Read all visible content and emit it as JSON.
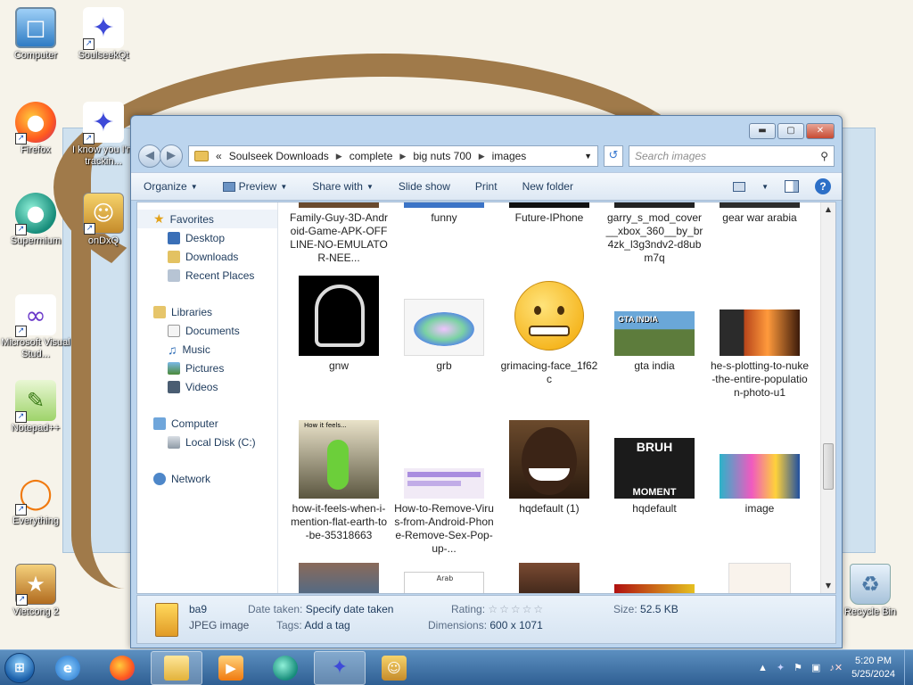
{
  "desktop": {
    "icons": [
      {
        "label": "Computer"
      },
      {
        "label": "SoulseekQt"
      },
      {
        "label": "Firefox"
      },
      {
        "label": "I know you I'm trackin..."
      },
      {
        "label": "Supermium"
      },
      {
        "label": "onDxQ"
      },
      {
        "label": "Microsoft Visual Stud..."
      },
      {
        "label": "Notepad++"
      },
      {
        "label": "Everything"
      },
      {
        "label": "Vietcong 2"
      },
      {
        "label": "Recycle Bin"
      }
    ]
  },
  "explorer": {
    "address": {
      "crumb_prefix": "«",
      "crumbs": [
        "Soulseek Downloads",
        "complete",
        "big nuts 700",
        "images"
      ]
    },
    "search_placeholder": "Search images",
    "toolbar": {
      "organize": "Organize",
      "preview": "Preview",
      "share_with": "Share with",
      "slide_show": "Slide show",
      "print": "Print",
      "new_folder": "New folder"
    },
    "nav": {
      "favorites": "Favorites",
      "desktop": "Desktop",
      "downloads": "Downloads",
      "recent_places": "Recent Places",
      "libraries": "Libraries",
      "documents": "Documents",
      "music": "Music",
      "pictures": "Pictures",
      "videos": "Videos",
      "computer": "Computer",
      "local_disk": "Local Disk (C:)",
      "network": "Network"
    },
    "files": [
      {
        "name": "Family-Guy-3D-Android-Game-APK-OFFLINE-NO-EMULATOR-NEE..."
      },
      {
        "name": "funny"
      },
      {
        "name": "Future-IPhone"
      },
      {
        "name": "garry_s_mod_cover__xbox_360__by_br4zk_l3g3ndv2-d8ubm7q"
      },
      {
        "name": "gear war arabia"
      },
      {
        "name": "gnw"
      },
      {
        "name": "grb"
      },
      {
        "name": "grimacing-face_1f62c"
      },
      {
        "name": "gta india"
      },
      {
        "name": "he-s-plotting-to-nuke-the-entire-population-photo-u1"
      },
      {
        "name": "how-it-feels-when-i-mention-flat-earth-to-be-35318663"
      },
      {
        "name": "How-to-Remove-Virus-from-Android-Phone-Remove-Sex-Pop-up-..."
      },
      {
        "name": "hqdefault (1)"
      },
      {
        "name": "hqdefault"
      },
      {
        "name": "image"
      }
    ],
    "thumb_text": {
      "gta_india": "GTA INDIA",
      "bruh": "BRUH",
      "moment": "MOMENT",
      "arab": "Arab",
      "how_it_feels": "How it feels..."
    },
    "details": {
      "filename": "ba9",
      "filetype": "JPEG image",
      "date_taken_label": "Date taken:",
      "date_taken_value": "Specify date taken",
      "tags_label": "Tags:",
      "tags_value": "Add a tag",
      "rating_label": "Rating:",
      "dimensions_label": "Dimensions:",
      "dimensions_value": "600 x 1071",
      "size_label": "Size:",
      "size_value": "52.5 KB"
    }
  },
  "taskbar": {
    "time": "5:20 PM",
    "date": "5/25/2024"
  }
}
